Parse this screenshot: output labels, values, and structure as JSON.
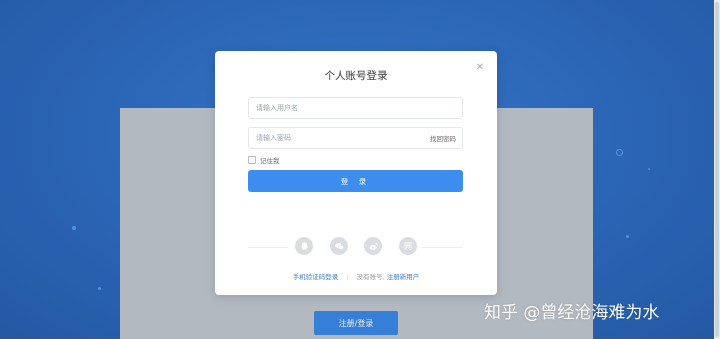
{
  "modal": {
    "title": "个人账号登录",
    "username_placeholder": "请输入用户名",
    "password_placeholder": "请输入密码",
    "forgot_password": "找回密码",
    "remember_me": "记住我",
    "login_button": "登 录",
    "social_icons": [
      "qq-icon",
      "wechat-icon",
      "weibo-icon",
      "netease-icon"
    ],
    "netease_label": "网",
    "phone_login": "手机验证码登录",
    "no_account": "没有账号,",
    "register_link": "注册新用户"
  },
  "background": {
    "register_login_button": "注册/登录"
  },
  "watermark": "知乎 @曾经沧海难为水",
  "colors": {
    "accent": "#3c8dee",
    "background": "#2e6cc2"
  }
}
